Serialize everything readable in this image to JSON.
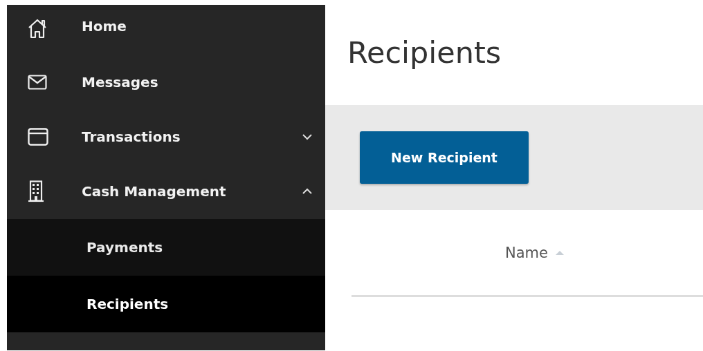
{
  "sidebar": {
    "items": [
      {
        "label": "Home",
        "kind": "home"
      },
      {
        "label": "Messages",
        "kind": "mail"
      },
      {
        "label": "Transactions",
        "kind": "card",
        "expanded": false
      },
      {
        "label": "Cash Management",
        "kind": "building",
        "expanded": true,
        "children": [
          {
            "label": "Payments",
            "selected": false
          },
          {
            "label": "Recipients",
            "selected": true
          }
        ]
      }
    ]
  },
  "page": {
    "title": "Recipients"
  },
  "toolbar": {
    "buttons": [
      "New Recipient"
    ]
  },
  "table": {
    "columns": [
      {
        "label": "Name",
        "sorted": true
      }
    ]
  }
}
